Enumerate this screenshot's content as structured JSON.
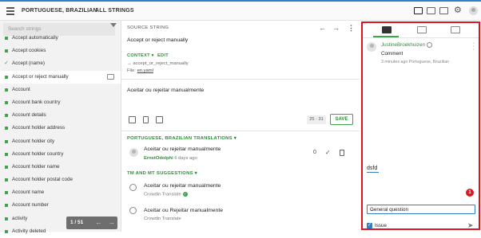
{
  "header": {
    "language": "PORTUGUESE, BRAZILIAN",
    "separator": "›",
    "section": "ALL STRINGS"
  },
  "sidebar": {
    "search_placeholder": "Search strings",
    "items": [
      {
        "label": "Accept automatically",
        "status": "translated"
      },
      {
        "label": "Accept cookies",
        "status": "translated"
      },
      {
        "label": "Accept (name)",
        "status": "approved"
      },
      {
        "label": "Accept or reject manually",
        "status": "translated",
        "selected": true,
        "has_comment": true
      },
      {
        "label": "Account",
        "status": "translated"
      },
      {
        "label": "Account bank country",
        "status": "translated"
      },
      {
        "label": "Account details",
        "status": "translated"
      },
      {
        "label": "Account holder address",
        "status": "translated"
      },
      {
        "label": "Account holder city",
        "status": "translated"
      },
      {
        "label": "Account holder country",
        "status": "translated"
      },
      {
        "label": "Account holder name",
        "status": "translated"
      },
      {
        "label": "Account holder postal code",
        "status": "translated"
      },
      {
        "label": "Account name",
        "status": "translated"
      },
      {
        "label": "Account number",
        "status": "translated"
      },
      {
        "label": "activity",
        "status": "translated"
      },
      {
        "label": "Activity deleted",
        "status": "translated"
      }
    ],
    "pager": {
      "page": "1",
      "total": "51",
      "label": "1 / 51"
    }
  },
  "editor": {
    "source_title": "SOURCE STRING",
    "source_text": "Accept or reject manually",
    "context_label": "CONTEXT ▾",
    "edit_label": "EDIT",
    "context_key": "→ accept_or_reject_manually",
    "file_prefix": "File:",
    "file_name": "en.yaml",
    "translation_input": "Aceitar ou rejeitar manualmente",
    "char_counter": "25 · 31",
    "save_label": "SAVE",
    "translations_title": "PORTUGUESE, BRAZILIAN TRANSLATIONS ▾",
    "translations": [
      {
        "text": "Aceitar ou rejeitar manualmente",
        "author": "ErnstOdolphi",
        "time": "6 days ago",
        "votes": "0"
      }
    ],
    "suggestions_title": "TM AND MT SUGGESTIONS ▾",
    "suggestions": [
      {
        "text": "Aceitar ou rejeitar manualmente",
        "source": "Crowdin Translate",
        "verified": true
      },
      {
        "text": "Aceitar ou Rejeitar manualmente",
        "source": "Crowdin Translate",
        "verified": false
      }
    ]
  },
  "comments": {
    "tabs": [
      "comments-icon",
      "source-context-icon",
      "history-icon"
    ],
    "items": [
      {
        "user": "JustineBroekhuizen",
        "body": "Comment",
        "meta": "3 minutes ago   Portuguese, Brazilian"
      }
    ],
    "input_value": "dsfd",
    "badge": "1",
    "type_selected": "General question",
    "issue_label": "Issue"
  },
  "colors": {
    "accent": "#2f80c9",
    "green": "#3fa34d",
    "highlight": "#e0141e"
  }
}
